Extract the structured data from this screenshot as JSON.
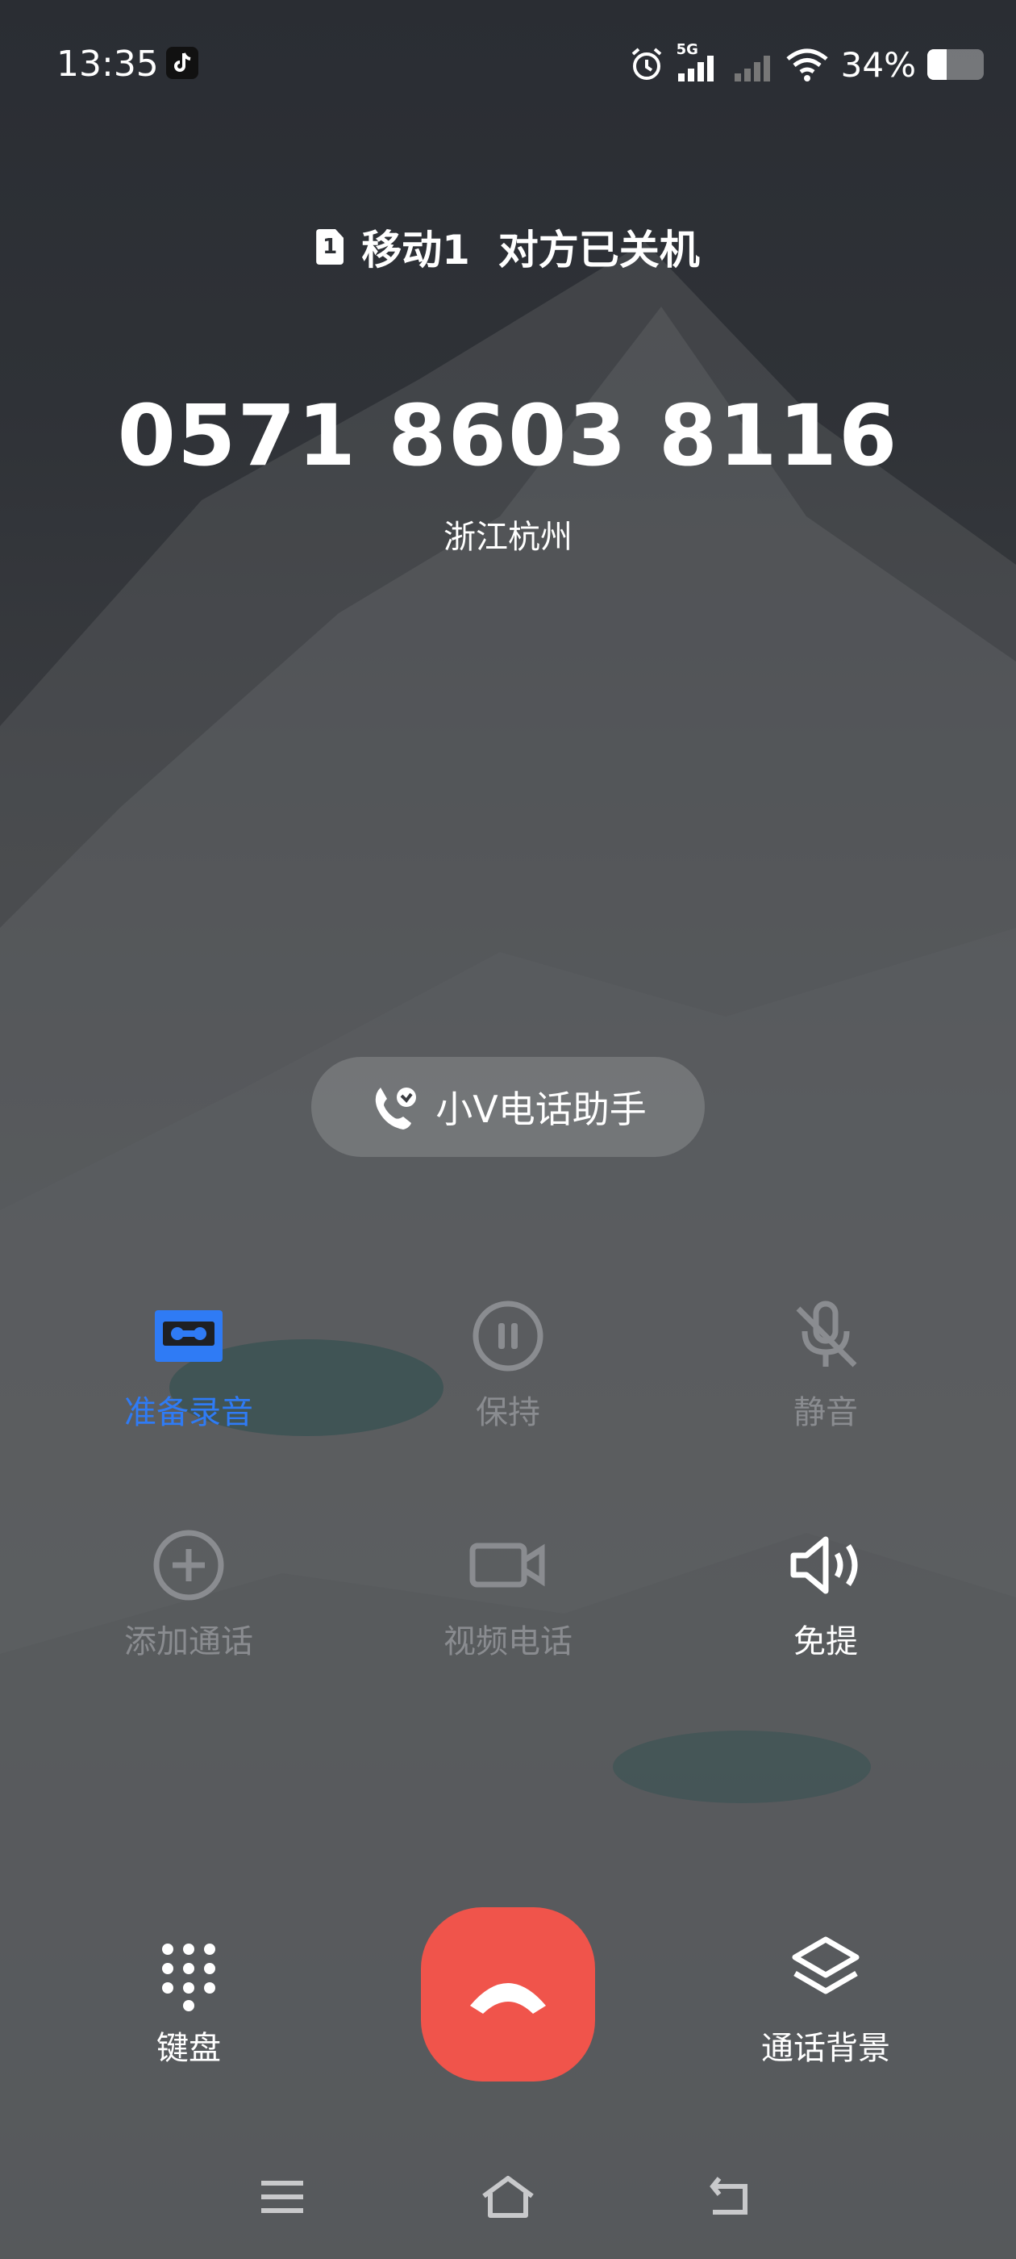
{
  "status_bar": {
    "time": "13:35",
    "network": "5G",
    "battery_percent": "34%",
    "battery_level": 0.34
  },
  "call": {
    "sim_index": "1",
    "sim_status": "移动1  对方已关机",
    "number": "0571 8603 8116",
    "location": "浙江杭州"
  },
  "assistant": {
    "label": "小V电话助手"
  },
  "controls": {
    "record": "准备录音",
    "hold": "保持",
    "mute": "静音",
    "add_call": "添加通话",
    "video_call": "视频电话",
    "speaker": "免提"
  },
  "bottom": {
    "keypad": "键盘",
    "call_background": "通话背景"
  },
  "colors": {
    "accent_blue": "#2f7bf5",
    "hangup_red": "#f0544b",
    "disabled_grey": "#8a8c90"
  }
}
